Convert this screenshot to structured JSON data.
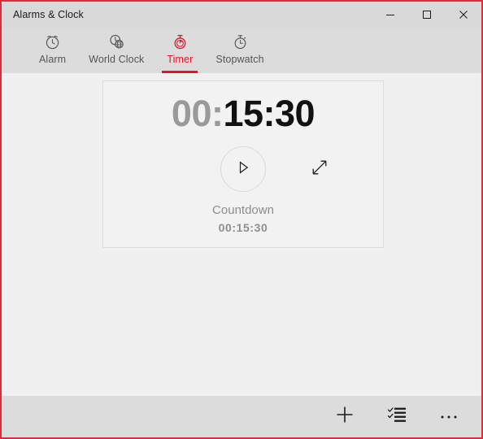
{
  "window": {
    "title": "Alarms & Clock",
    "accent_color": "#e81123",
    "border_color": "#e02b3c",
    "titlebar_bg": "#d9d9d9",
    "content_bg": "#f0f0f0",
    "commandbar_bg": "#dcdcdc"
  },
  "caption": {
    "minimize_label": "Minimize",
    "maximize_label": "Maximize",
    "close_label": "Close"
  },
  "tabs": [
    {
      "label": "Alarm",
      "icon": "alarm-clock-icon",
      "active": false
    },
    {
      "label": "World Clock",
      "icon": "globe-clock-icon",
      "active": false
    },
    {
      "label": "Timer",
      "icon": "timer-icon",
      "active": true
    },
    {
      "label": "Stopwatch",
      "icon": "stopwatch-icon",
      "active": false
    }
  ],
  "timer_card": {
    "hours": "00:",
    "minutes_seconds": "15:30",
    "full_time": "00:15:30",
    "hours_color": "#9a9a9a",
    "main_color": "#111111",
    "play_icon": "play-icon",
    "expand_icon": "expand-diagonal-icon",
    "name_label": "Countdown",
    "preset_value": "00:15:30"
  },
  "commandbar": {
    "add_label": "New timer",
    "select_label": "Select timers",
    "more_label": "See more",
    "add_icon": "plus-icon",
    "select_icon": "checklist-icon",
    "more_icon": "ellipsis-icon"
  }
}
